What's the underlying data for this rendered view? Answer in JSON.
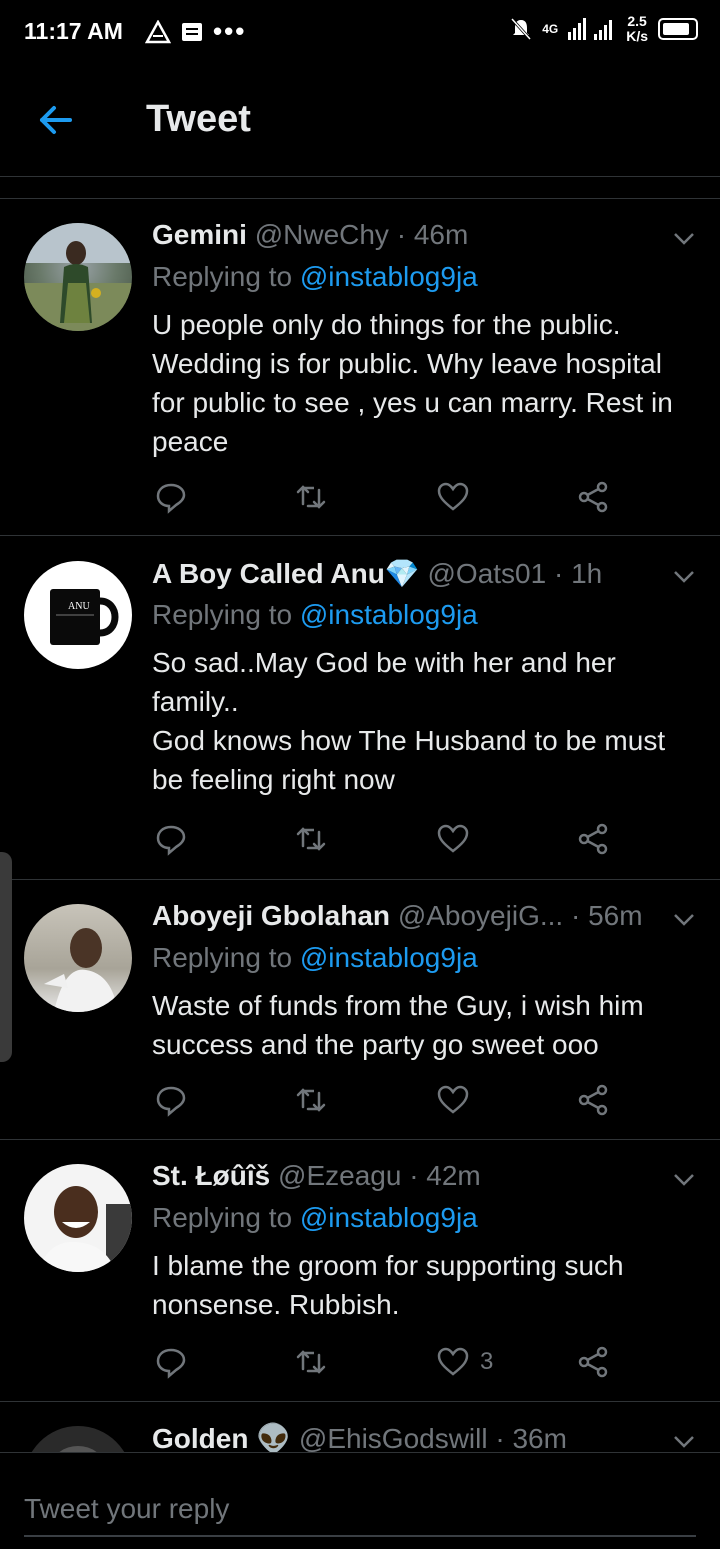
{
  "status_bar": {
    "time": "11:17 AM",
    "network": "4G",
    "speed_top": "2.5",
    "speed_bottom": "K/s"
  },
  "header": {
    "title": "Tweet"
  },
  "tweets": [
    {
      "name": "Gemini",
      "handle": "@NweChy",
      "time": "· 46m",
      "replying_prefix": "Replying to ",
      "replying_to": "@instablog9ja",
      "text": "U people only do things for the public. Wedding is for public. Why leave hospital for public to see , yes u can marry. Rest in peace",
      "likes": ""
    },
    {
      "name": "A Boy Called Anu",
      "name_emoji": "💎",
      "handle": "@Oats01",
      "time": "· 1h",
      "replying_prefix": "Replying to ",
      "replying_to": "@instablog9ja",
      "text": "So sad..May God be with her and her family..\nGod knows how The Husband to be must be feeling right now",
      "likes": ""
    },
    {
      "name": "Aboyeji Gbolahan",
      "handle": "@AboyejiG...",
      "time": "· 56m",
      "replying_prefix": "Replying to ",
      "replying_to": "@instablog9ja",
      "text": "Waste of funds from the Guy, i wish him success and the party go sweet ooo",
      "likes": ""
    },
    {
      "name": "St. Łøûîš",
      "handle": "@Ezeagu",
      "time": "· 42m",
      "replying_prefix": "Replying to ",
      "replying_to": "@instablog9ja",
      "text": "I blame the groom for supporting such nonsense. Rubbish.",
      "likes": "3"
    },
    {
      "name": "Golden",
      "name_emoji": "👽",
      "handle": "@EhisGodswill",
      "time": "· 36m"
    }
  ],
  "compose": {
    "placeholder": "Tweet your reply"
  },
  "colors": {
    "accent": "#1d9bf0",
    "muted": "#71767b",
    "text": "#e7e9ea",
    "divider": "#2f3336"
  }
}
